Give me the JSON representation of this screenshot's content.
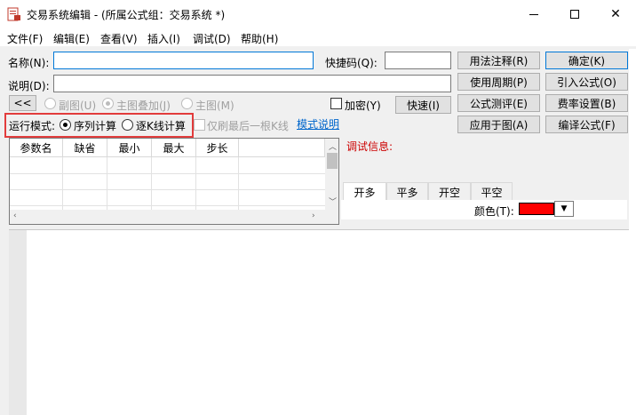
{
  "window": {
    "title": "交易系统编辑 - (所属公式组：交易系统 *)",
    "minimize_glyph": "—",
    "close_glyph": "✕"
  },
  "menu": [
    "文件(F)",
    "编辑(E)",
    "查看(V)",
    "插入(I)",
    "调试(D)",
    "帮助(H)"
  ],
  "form": {
    "name_label": "名称(N):",
    "name_value": "",
    "shortcut_label": "快捷码(Q):",
    "shortcut_value": "",
    "desc_label": "说明(D):",
    "desc_value": ""
  },
  "buttons": {
    "usage_note": "用法注释(R)",
    "confirm": "确定(K)",
    "use_period": "使用周期(P)",
    "import_formula": "引入公式(O)",
    "formula_test": "公式测评(E)",
    "fee_setting": "费率设置(B)",
    "apply_to_chart": "应用于图(A)",
    "compile_formula": "编译公式(F)",
    "collapse": "<<",
    "fast": "快速(I)"
  },
  "chart_options": {
    "sub_chart": "副图(U)",
    "main_overlay": "主图叠加(J)",
    "main_chart": "主图(M)",
    "encrypt": "加密(Y)"
  },
  "run_mode": {
    "label": "运行模式:",
    "sequential": "序列计算",
    "per_bar": "逐K线计算",
    "last_bar_only": "仅刷最后一根K线",
    "mode_help_link": "模式说明"
  },
  "param_grid": {
    "headers": [
      "参数名",
      "缺省",
      "最小",
      "最大",
      "步长"
    ]
  },
  "debug": {
    "label": "调试信息:"
  },
  "signal_tabs": [
    "开多",
    "平多",
    "开空",
    "平空"
  ],
  "color": {
    "label": "颜色(T):",
    "value": "#ff0000"
  }
}
